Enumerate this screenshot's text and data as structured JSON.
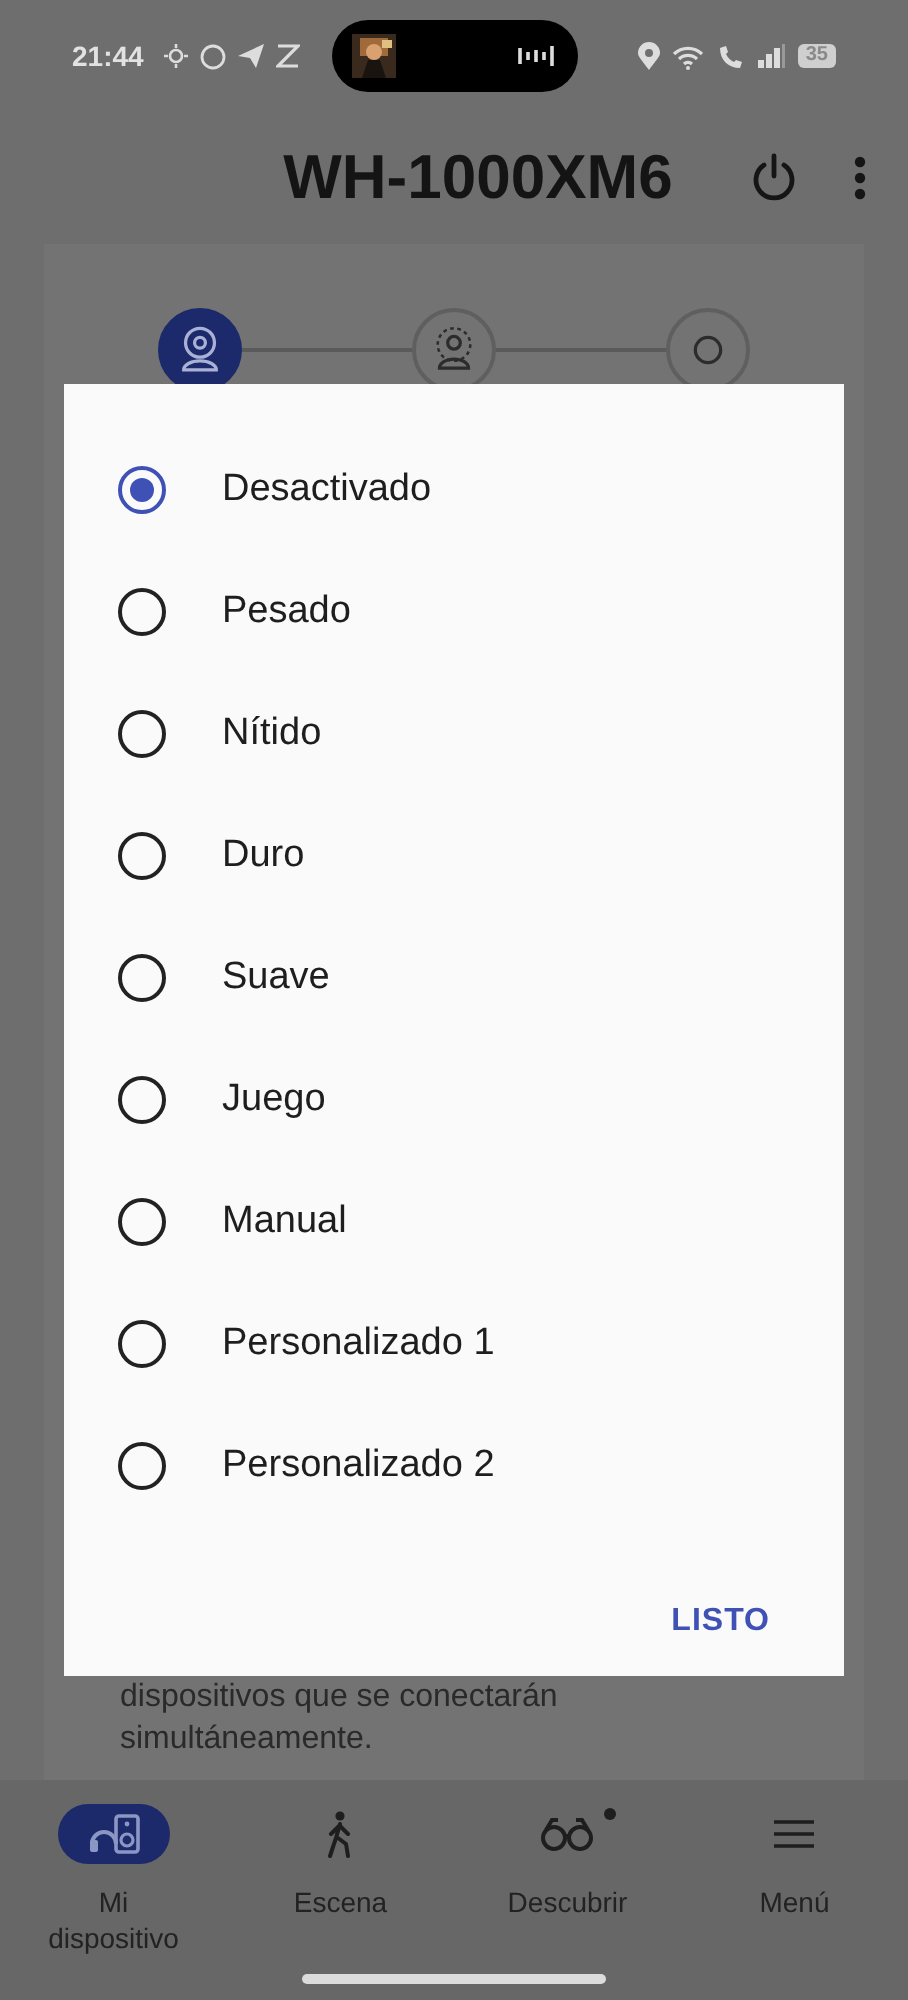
{
  "status_bar": {
    "time": "21:44",
    "battery": "35"
  },
  "header": {
    "title": "WH-1000XM6"
  },
  "steps": [
    {
      "selected": true
    },
    {
      "selected": false
    },
    {
      "selected": false
    }
  ],
  "background_text": "dispositivos que se conectarán simultáneamente.",
  "dialog": {
    "options": [
      {
        "label": "Desactivado",
        "selected": true
      },
      {
        "label": "Pesado",
        "selected": false
      },
      {
        "label": "Nítido",
        "selected": false
      },
      {
        "label": "Duro",
        "selected": false
      },
      {
        "label": "Suave",
        "selected": false
      },
      {
        "label": "Juego",
        "selected": false
      },
      {
        "label": "Manual",
        "selected": false
      },
      {
        "label": "Personalizado 1",
        "selected": false
      },
      {
        "label": "Personalizado 2",
        "selected": false
      }
    ],
    "button": "LISTO"
  },
  "bottom_nav": [
    {
      "label": "Mi dispositivo",
      "kind": "device",
      "selected": true,
      "dot": false
    },
    {
      "label": "Escena",
      "kind": "walk",
      "selected": false,
      "dot": false
    },
    {
      "label": "Descubrir",
      "kind": "binoculars",
      "selected": false,
      "dot": true
    },
    {
      "label": "Menú",
      "kind": "menu",
      "selected": false,
      "dot": false
    }
  ]
}
